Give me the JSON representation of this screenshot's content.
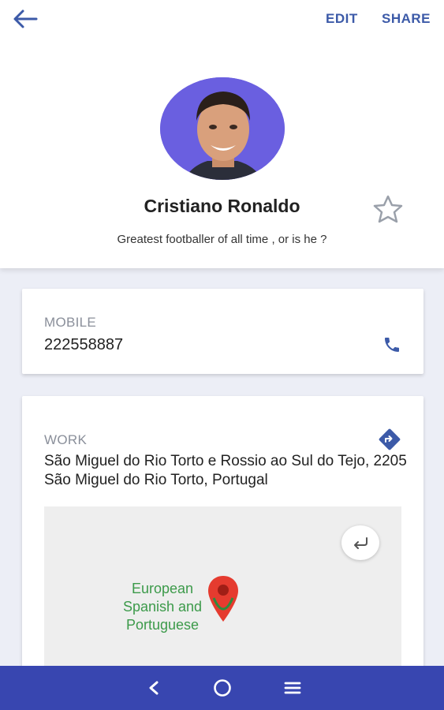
{
  "toolbar": {
    "edit_label": "EDIT",
    "share_label": "SHARE",
    "accent_color": "#3c5aa8"
  },
  "profile": {
    "name": "Cristiano Ronaldo",
    "bio": "Greatest footballer of all time , or is he ?",
    "avatar_bg": "#6a5fe0",
    "favorite": false
  },
  "mobile": {
    "label": "MOBILE",
    "number": "222558887"
  },
  "work": {
    "label": "WORK",
    "address": "São Miguel do Rio Torto e Rossio ao Sul do Tejo, 2205 São Miguel do Rio Torto, Portugal"
  },
  "map": {
    "place_label": "European Spanish and Portuguese",
    "pin_color": "#e53b2f"
  },
  "navbar": {
    "color": "#3846b0",
    "icons": [
      "nav-back-icon",
      "nav-home-icon",
      "nav-menu-icon"
    ]
  }
}
